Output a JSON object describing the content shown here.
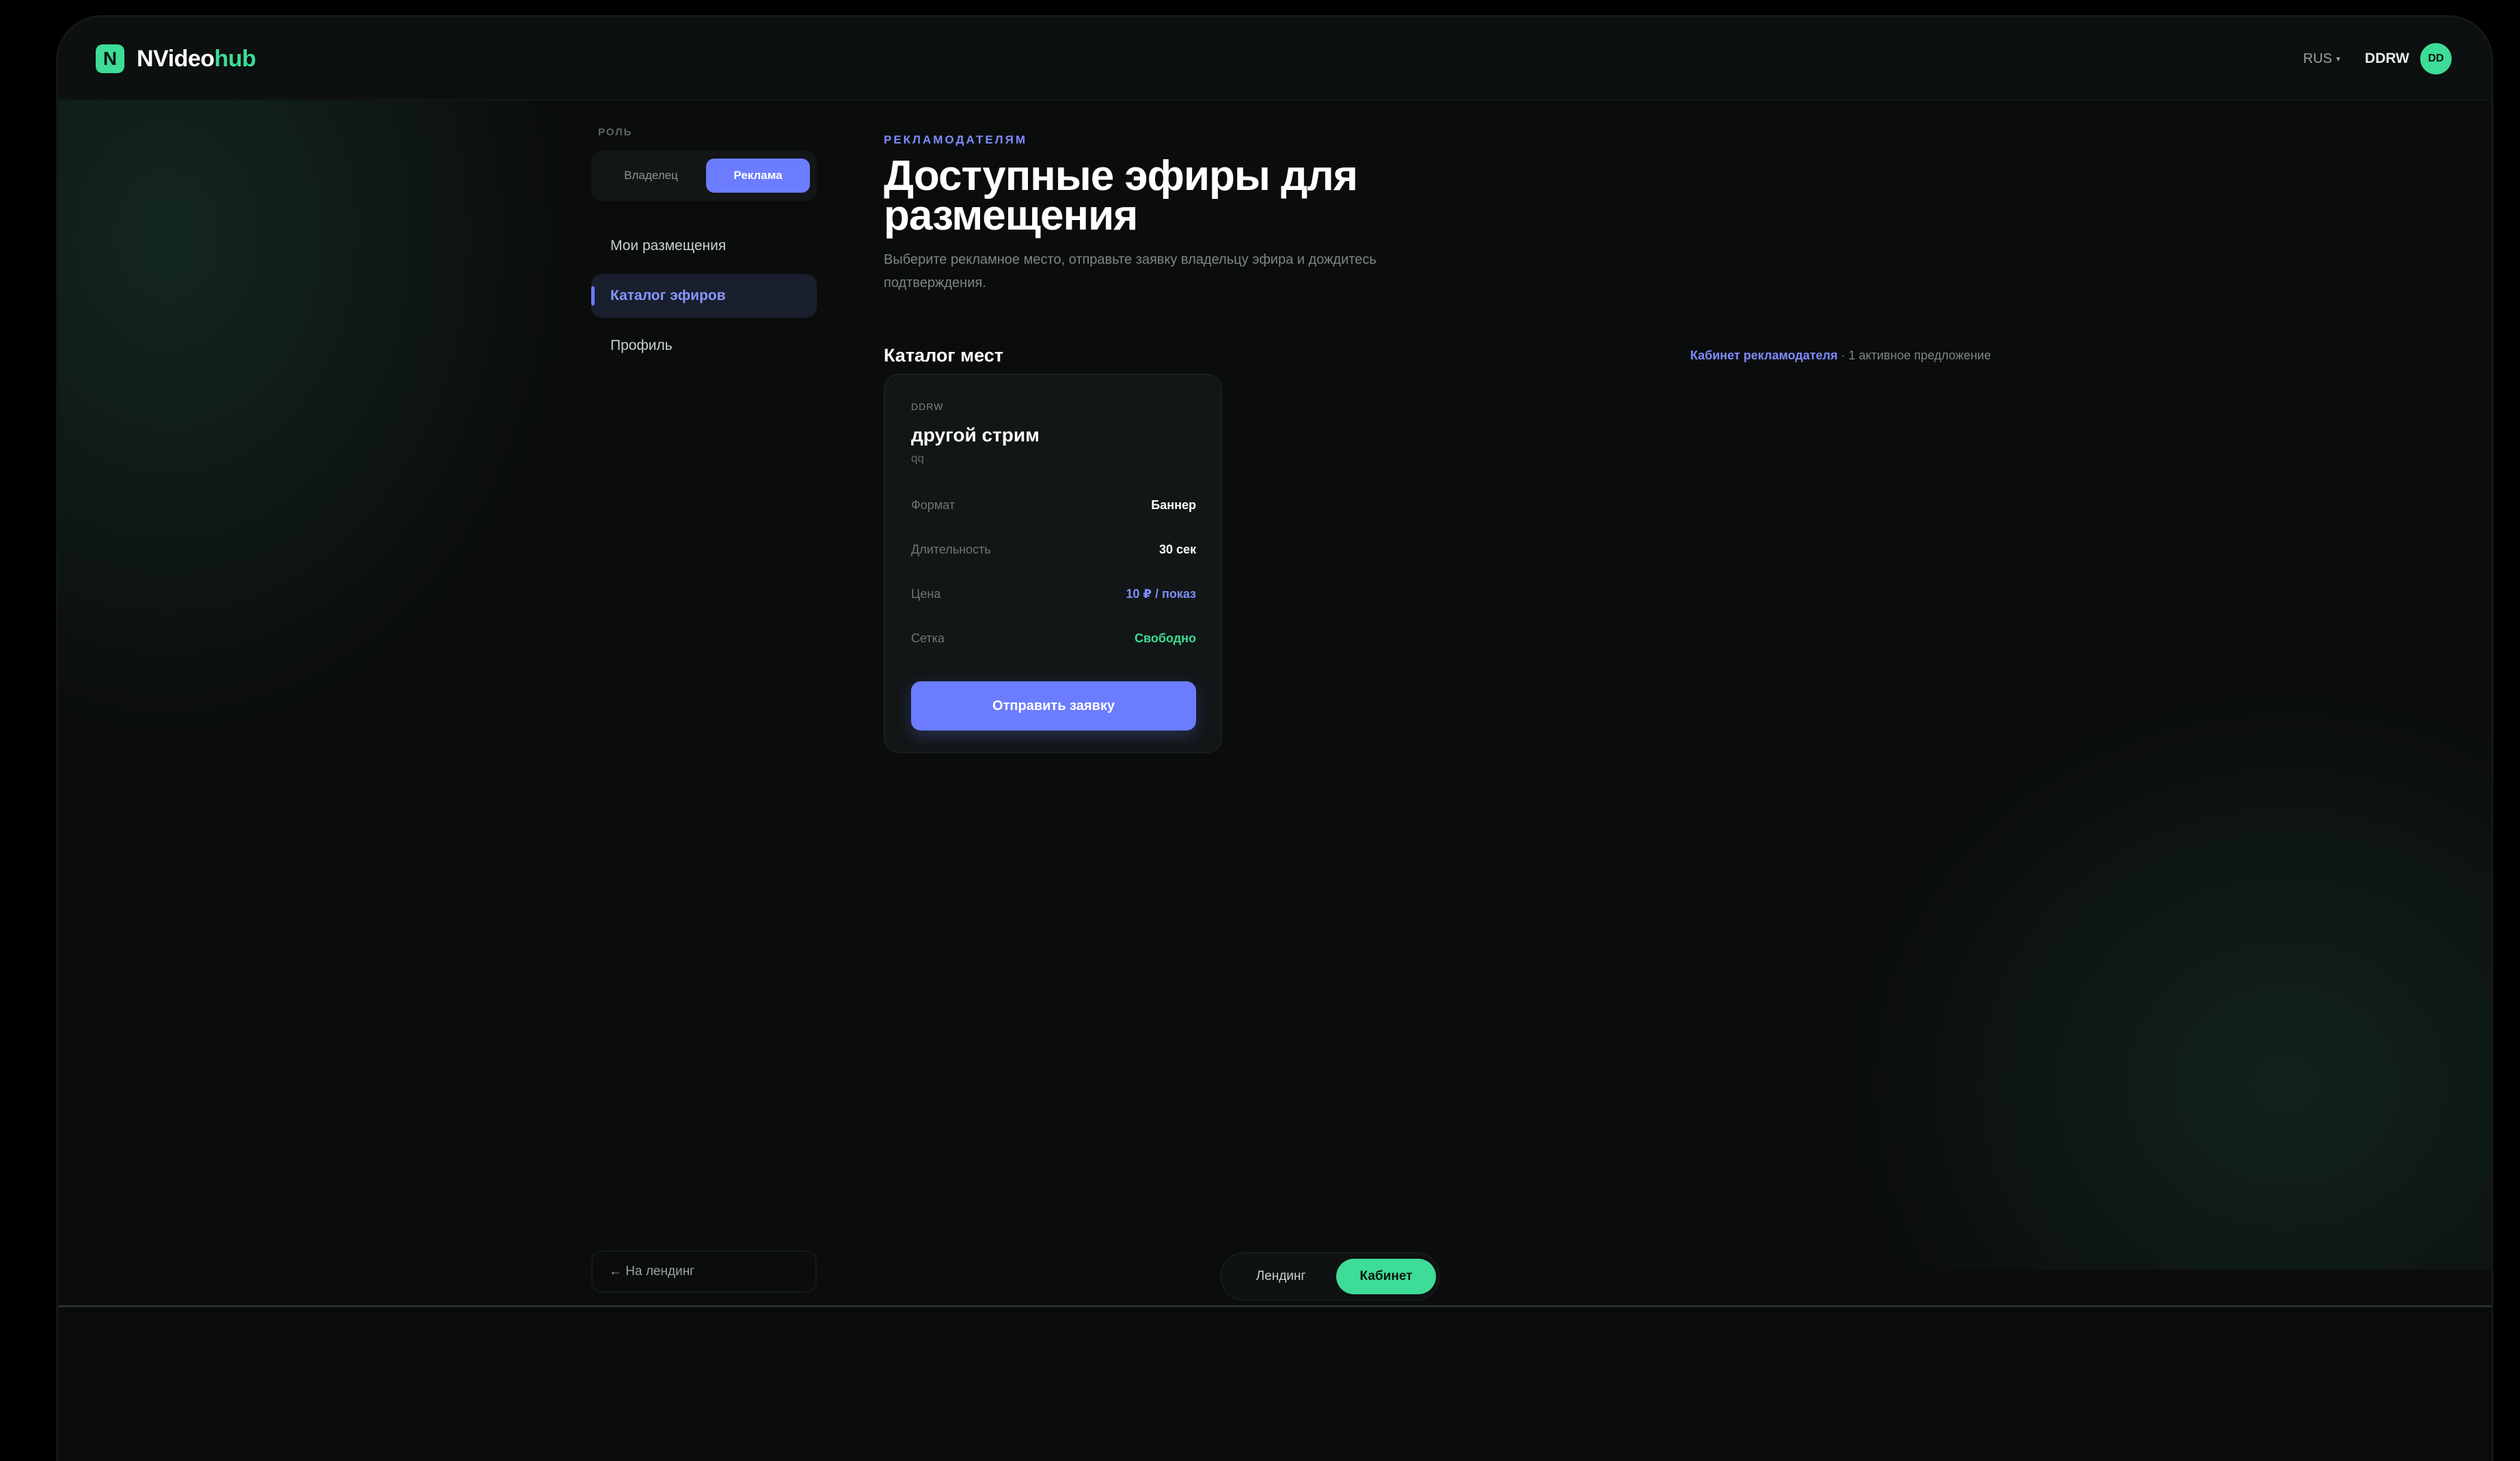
{
  "app": {
    "logo_mark": "N",
    "logo_name_a": "NVideo",
    "logo_name_b": "hub",
    "accent_green": "#3ddc97",
    "accent_blue": "#6b7cff"
  },
  "topbar": {
    "language": "RUS",
    "user_name": "DDRW",
    "avatar_initials": "DD"
  },
  "sidebar": {
    "role_label": "РОЛЬ",
    "role_owner": "Владелец",
    "role_ads": "Реклама",
    "items": [
      {
        "label": "Мои размещения"
      },
      {
        "label": "Каталог эфиров"
      },
      {
        "label": "Профиль"
      }
    ],
    "back_link": "← На лендинг"
  },
  "main": {
    "eyebrow": "РЕКЛАМОДАТЕЛЯМ",
    "title": "Доступные эфиры для размещения",
    "subtitle": "Выберите рекламное место, отправьте заявку владельцу эфира и дождитесь подтверждения.",
    "catalog_title": "Каталог мест",
    "catalog_meta_link": "Кабинет рекламодателя",
    "catalog_meta_text": "· 1 активное предложение"
  },
  "card": {
    "owner": "DDRW",
    "title": "другой стрим",
    "description": "qq",
    "rows": [
      {
        "label": "Формат",
        "value": "Баннер"
      },
      {
        "label": "Длительность",
        "value": "30 сек"
      },
      {
        "label": "Цена",
        "value": "10 ₽ / показ"
      },
      {
        "label": "Сетка",
        "value": "Свободно"
      }
    ],
    "button": "Отправить заявку"
  },
  "bottom_toggle": {
    "landing": "Лендинг",
    "cabinet": "Кабинет"
  }
}
